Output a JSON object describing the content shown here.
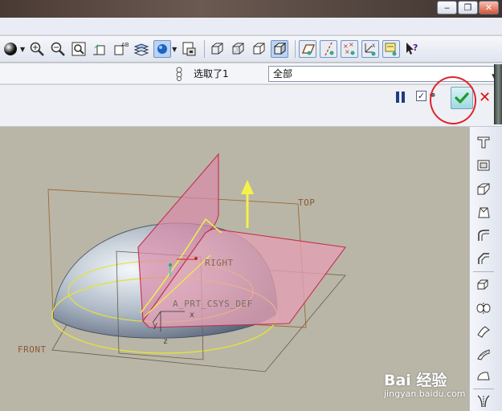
{
  "window": {
    "controls": [
      "minimize",
      "maximize",
      "close"
    ],
    "control_glyphs": [
      "‒",
      "❐",
      "✕"
    ]
  },
  "toolbar": {
    "icons": [
      "shading-sphere-icon",
      "zoom-in-icon",
      "zoom-out-icon",
      "refit-icon",
      "reorient-icon",
      "saved-views-icon",
      "layers-icon",
      "display-style-icon",
      "repaint-icon",
      "wireframe-icon",
      "hidden-line-icon",
      "no-hidden-icon",
      "shaded-icon",
      "datum-planes-icon",
      "datum-axes-icon",
      "datum-points-icon",
      "coordinate-systems-icon",
      "annotations-icon",
      "whats-this-icon"
    ]
  },
  "selection": {
    "status_text": "选取了1",
    "filter_value": "全部"
  },
  "dashboard": {
    "checkbox_checked": true,
    "accent_color": "#1f9a2e",
    "cancel_color": "#dd1111",
    "annotation_color": "#e0242a"
  },
  "viewport": {
    "labels": {
      "top": "TOP",
      "right": "RIGHT",
      "front": "FRONT",
      "csys": "A_PRT_CSYS_DEF",
      "x": "x",
      "y": "y",
      "z": "z"
    },
    "background_color": "#b9b6a7",
    "plane_color": "#e3a0b4",
    "edge_color": "#f0ee4a"
  },
  "watermark": {
    "text": "Bai 经验",
    "sub": "jingyan.baidu.com"
  },
  "right_toolbar": {
    "icons": [
      "hole-icon",
      "shell-icon",
      "rib-icon",
      "draft-icon",
      "round-icon",
      "chamfer-icon",
      "extrude-icon",
      "revolve-icon",
      "sweep-icon",
      "blend-icon",
      "boundary-icon",
      "mirror-icon"
    ]
  }
}
